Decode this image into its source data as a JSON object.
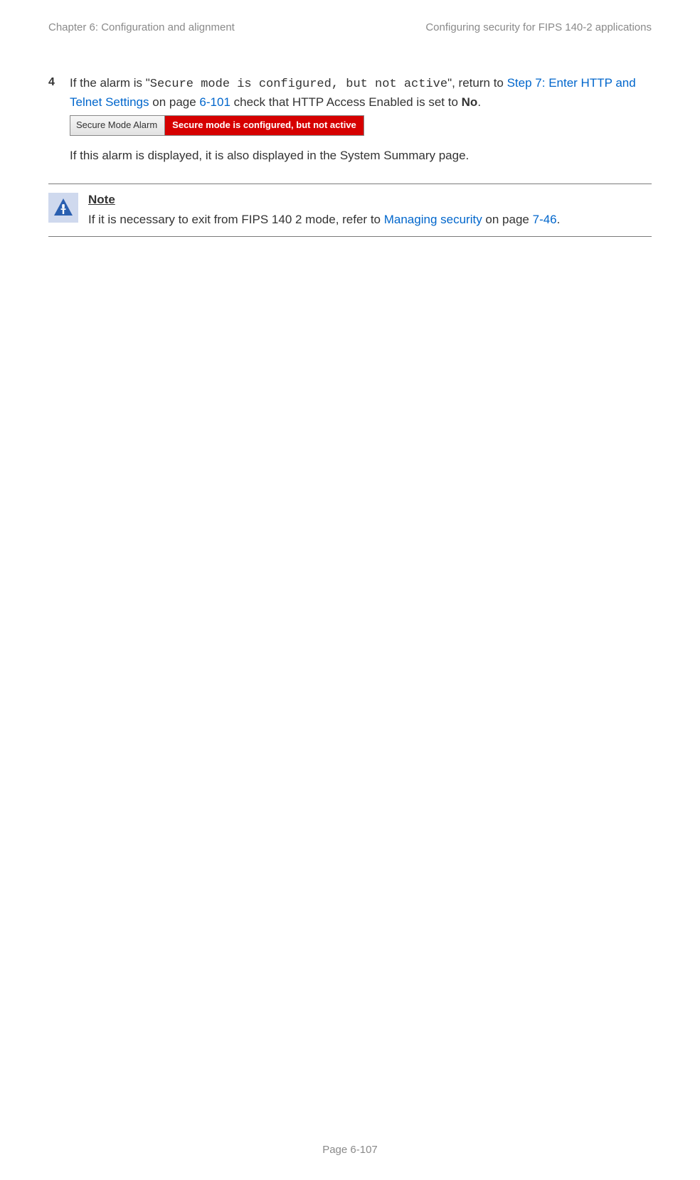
{
  "header": {
    "left": "Chapter 6:  Configuration and alignment",
    "right": "Configuring security for FIPS 140-2 applications"
  },
  "step": {
    "number": "4",
    "text_prefix": "If the alarm is \"",
    "alarm_quote": "Secure mode is configured, but not active",
    "text_mid1": "\", return to ",
    "link1": "Step 7: Enter HTTP and Telnet Settings",
    "text_mid2": " on page ",
    "page_ref": "6-101",
    "text_mid3": " check that HTTP Access Enabled is set to ",
    "bold_no": "No",
    "text_end": ".",
    "alarm_box_label": "Secure Mode Alarm",
    "alarm_box_value": "Secure mode is configured, but not active",
    "after_alarm": "If this alarm is displayed, it is also displayed in the System Summary page."
  },
  "note": {
    "title": "Note",
    "body_prefix": "If it is necessary to exit from FIPS 140 2 mode, refer to ",
    "link": "Managing security",
    "body_mid": " on page ",
    "page_ref": "7-46",
    "body_end": "."
  },
  "footer": {
    "page_label": "Page 6-107"
  }
}
